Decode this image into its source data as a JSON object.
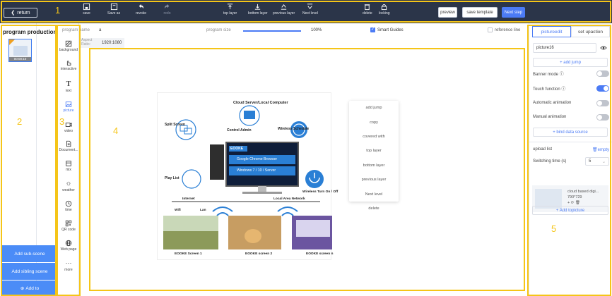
{
  "toolbar": {
    "return_label": "return",
    "tools": [
      {
        "label": "save",
        "icon": "save-icon"
      },
      {
        "label": "Save as",
        "icon": "save-as-icon"
      },
      {
        "label": "revoke",
        "icon": "undo-icon"
      },
      {
        "label": "redo",
        "icon": "redo-icon"
      },
      {
        "label": "top layer",
        "icon": "top-layer-icon"
      },
      {
        "label": "bottom layer",
        "icon": "bottom-layer-icon"
      },
      {
        "label": "previous layer",
        "icon": "previous-layer-icon"
      },
      {
        "label": "Next level",
        "icon": "next-level-icon"
      },
      {
        "label": "delete",
        "icon": "delete-icon"
      },
      {
        "label": "locking",
        "icon": "lock-icon"
      }
    ],
    "preview_label": "preview",
    "save_template_label": "save template",
    "next_step_label": "Next step"
  },
  "left_panel": {
    "title": "program production(1)",
    "thumb_time": "00:00:10",
    "add_sub_scene": "Add sub-scene",
    "add_sibling_scene": "Add sibling scene",
    "add_to": "Add to"
  },
  "widgets": [
    {
      "label": "background",
      "icon": "background-icon"
    },
    {
      "label": "interactive",
      "icon": "interactive-icon"
    },
    {
      "label": "text",
      "icon": "text-icon"
    },
    {
      "label": "picture",
      "icon": "picture-icon",
      "active": true
    },
    {
      "label": "video",
      "icon": "video-icon"
    },
    {
      "label": "Document...",
      "icon": "document-icon"
    },
    {
      "label": "mix",
      "icon": "mix-icon"
    },
    {
      "label": "weather",
      "icon": "weather-icon"
    },
    {
      "label": "time",
      "icon": "clock-icon"
    },
    {
      "label": "QR code",
      "icon": "qr-code-icon"
    },
    {
      "label": "Web page",
      "icon": "globe-icon"
    },
    {
      "label": "more",
      "icon": "more-icon"
    }
  ],
  "info_bar": {
    "program_name_label": "program name",
    "program_name_value": "a",
    "program_size_label": "program size",
    "zoom": "100%",
    "zoom_fraction": 1.0,
    "smart_guides_label": "Smart Guides",
    "smart_guides_checked": true,
    "reference_line_label": "reference line",
    "reference_line_checked": false
  },
  "canvas": {
    "aspect_ratio_label": "Aspect Ratio:",
    "resolution": "1920:1080"
  },
  "artwork": {
    "server_label": "Cloud Server/Local Computer",
    "split_screen": "Split Screen",
    "control_admin": "Control Admin",
    "wireless_schedule": "Wireless Schedule",
    "play_list": "Play List",
    "brand": "EOOKE",
    "browser": "Google Chrome Browser",
    "os": "Windows 7 / 10 / Server",
    "power": "Wireless Turn On / Off",
    "internet": "Internet",
    "lan_network": "Local Area Network",
    "wifi": "Wifi",
    "lan": "Lan",
    "screen1": "EOOKE Screen 1",
    "screen2": "EOOKE screen 2",
    "screenN": "EOOKE screen n"
  },
  "context_menu": [
    "add jump",
    "copy",
    "covered with",
    "top layer",
    "bottom layer",
    "previous layer",
    "Next level",
    "delete"
  ],
  "right_panel": {
    "tab_picture_edit": "pictureedit",
    "tab_set_up_action": "set upaction",
    "picture_name": "picture16",
    "add_jump": "+ add jump",
    "banner_mode": "Banner mode",
    "banner_mode_on": false,
    "touch_function": "Touch function",
    "touch_function_on": true,
    "automatic_animation": "Automatic animation",
    "automatic_animation_on": false,
    "manual_animation": "Manual animation",
    "manual_animation_on": false,
    "bind_data_source": "+ bind data source",
    "upload_list": "upload list",
    "empty": "empty",
    "switching_time_label": "Switching time (s)",
    "switching_time_value": "5",
    "upload_item_name": "cloud based digi...",
    "upload_item_size": "790*729",
    "add_topicture": "+ Add topicture"
  },
  "annotations": [
    "1",
    "2",
    "3",
    "4",
    "5"
  ],
  "colors": {
    "toolbar_bg": "#2b3549",
    "accent": "#4b7bf5",
    "annotation": "#f5c518"
  }
}
